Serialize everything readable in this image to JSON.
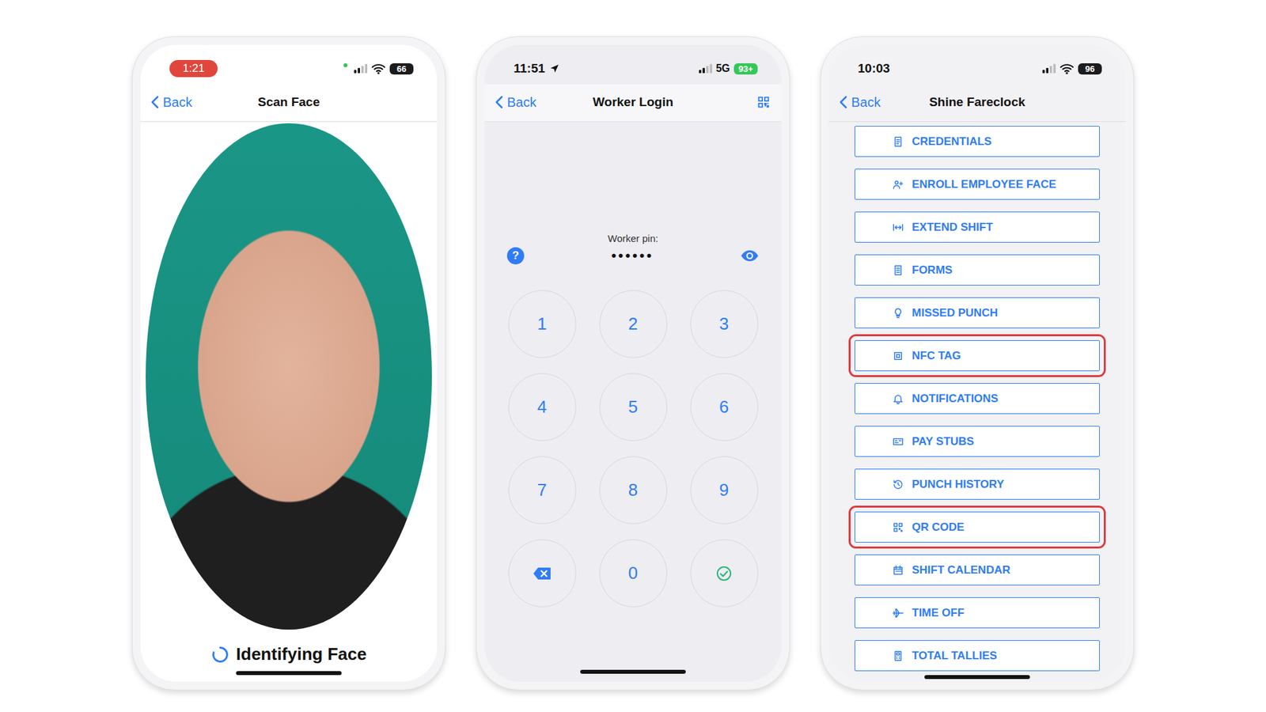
{
  "phones": [
    {
      "kind": "scan-face",
      "status": {
        "time": "1:21",
        "time_pill": true,
        "location": false,
        "network": "",
        "battery": "66",
        "charging": false,
        "camera_in_use": true
      },
      "nav": {
        "back": "Back",
        "title": "Scan Face",
        "qr_button": false
      },
      "face_scan": {
        "status": "Identifying Face",
        "busy": true
      }
    },
    {
      "kind": "worker-login",
      "status": {
        "time": "11:51",
        "time_pill": false,
        "location": true,
        "network": "5G",
        "battery": "93+",
        "charging": true,
        "camera_in_use": false
      },
      "nav": {
        "back": "Back",
        "title": "Worker Login",
        "qr_button": true
      },
      "login": {
        "label": "Worker pin:",
        "pin": "••••••",
        "help": "?",
        "keys": [
          {
            "kind": "digit",
            "label": "1"
          },
          {
            "kind": "digit",
            "label": "2"
          },
          {
            "kind": "digit",
            "label": "3"
          },
          {
            "kind": "digit",
            "label": "4"
          },
          {
            "kind": "digit",
            "label": "5"
          },
          {
            "kind": "digit",
            "label": "6"
          },
          {
            "kind": "digit",
            "label": "7"
          },
          {
            "kind": "digit",
            "label": "8"
          },
          {
            "kind": "digit",
            "label": "9"
          },
          {
            "kind": "delete"
          },
          {
            "kind": "digit",
            "label": "0"
          },
          {
            "kind": "submit"
          }
        ]
      }
    },
    {
      "kind": "menu",
      "status": {
        "time": "10:03",
        "time_pill": false,
        "location": false,
        "network": "",
        "battery": "96",
        "charging": false,
        "camera_in_use": false
      },
      "nav": {
        "back": "Back",
        "title": "Shine Fareclock",
        "qr_button": false
      },
      "menu": [
        {
          "label": "CREDENTIALS",
          "highlighted": false
        },
        {
          "label": "ENROLL EMPLOYEE FACE",
          "highlighted": false
        },
        {
          "label": "EXTEND SHIFT",
          "highlighted": false
        },
        {
          "label": "FORMS",
          "highlighted": false
        },
        {
          "label": "MISSED PUNCH",
          "highlighted": false
        },
        {
          "label": "NFC TAG",
          "highlighted": true
        },
        {
          "label": "NOTIFICATIONS",
          "highlighted": false
        },
        {
          "label": "PAY STUBS",
          "highlighted": false
        },
        {
          "label": "PUNCH HISTORY",
          "highlighted": false
        },
        {
          "label": "QR CODE",
          "highlighted": true
        },
        {
          "label": "SHIFT CALENDAR",
          "highlighted": false
        },
        {
          "label": "TIME OFF",
          "highlighted": false
        },
        {
          "label": "TOTAL TALLIES",
          "highlighted": false
        }
      ]
    }
  ]
}
